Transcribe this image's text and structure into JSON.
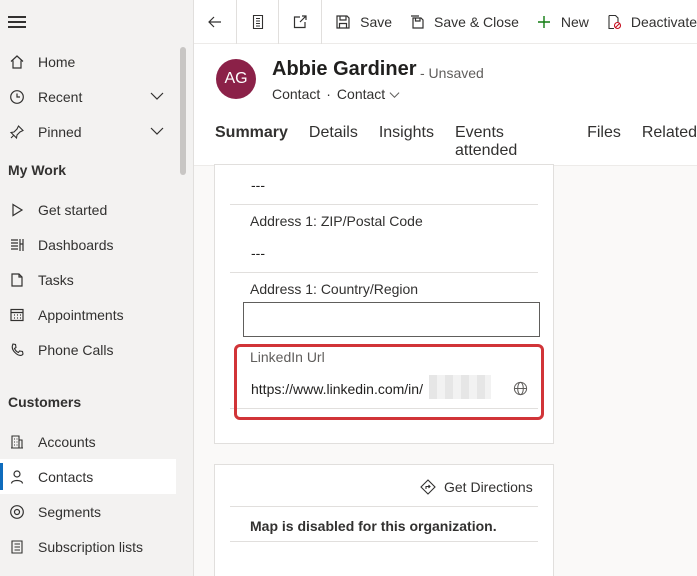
{
  "nav": {
    "home": "Home",
    "recent": "Recent",
    "pinned": "Pinned",
    "my_work_title": "My Work",
    "get_started": "Get started",
    "dashboards": "Dashboards",
    "tasks": "Tasks",
    "appointments": "Appointments",
    "phone_calls": "Phone Calls",
    "customers_title": "Customers",
    "accounts": "Accounts",
    "contacts": "Contacts",
    "segments": "Segments",
    "subscription_lists": "Subscription lists"
  },
  "toolbar": {
    "save": "Save",
    "save_close": "Save & Close",
    "new": "New",
    "deactivate": "Deactivate"
  },
  "record": {
    "initials": "AG",
    "name": "Abbie Gardiner",
    "status": "- Unsaved",
    "entity": "Contact",
    "separator": "·",
    "form": "Contact"
  },
  "tabs": [
    "Summary",
    "Details",
    "Insights",
    "Events attended",
    "Files",
    "Related"
  ],
  "form": {
    "top_value": "---",
    "zip_label": "Address 1: ZIP/Postal Code",
    "zip_value": "---",
    "country_label": "Address 1: Country/Region",
    "country_value": "",
    "linkedin_label": "LinkedIn Url",
    "linkedin_value": "https://www.linkedin.com/in/"
  },
  "map": {
    "directions": "Get Directions",
    "disabled_msg": "Map is disabled for this organization."
  },
  "colors": {
    "accent": "#0f6cbd",
    "avatar": "#8b2148",
    "highlight": "#d13438",
    "new_icon": "#107c10"
  }
}
